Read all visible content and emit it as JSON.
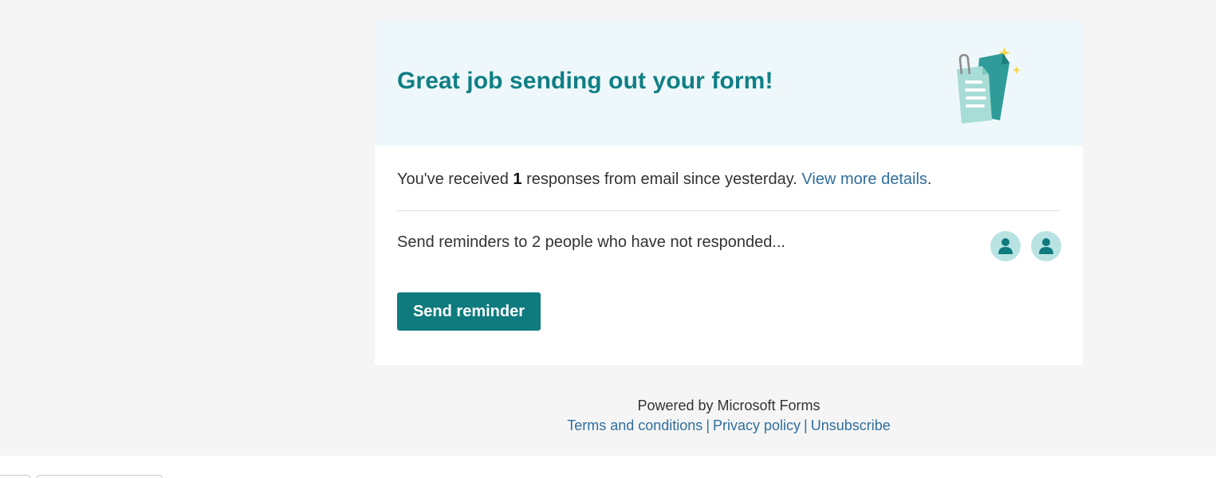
{
  "hero": {
    "title": "Great job sending out your form!",
    "illustration_icon": "forms-document-illustration"
  },
  "summary": {
    "prefix": "You've received ",
    "count": "1",
    "suffix": " responses from email since yesterday. ",
    "link_label": "View more details",
    "trailing": "."
  },
  "reminder": {
    "text": "Send reminders to 2 people who have not responded...",
    "avatar_icon": "person-icon",
    "avatar_count": 2,
    "button_label": "Send reminder"
  },
  "footer": {
    "powered_by": "Powered by Microsoft Forms",
    "links": [
      "Terms and conditions",
      "Privacy policy",
      "Unsubscribe"
    ],
    "separator": "|"
  },
  "colors": {
    "accent": "#0f7b7e",
    "title": "#107f84",
    "hero_background": "#eef8fb",
    "page_background": "#f5f5f5",
    "link": "#2f6e9e",
    "avatar_background": "#b9e3e3"
  }
}
